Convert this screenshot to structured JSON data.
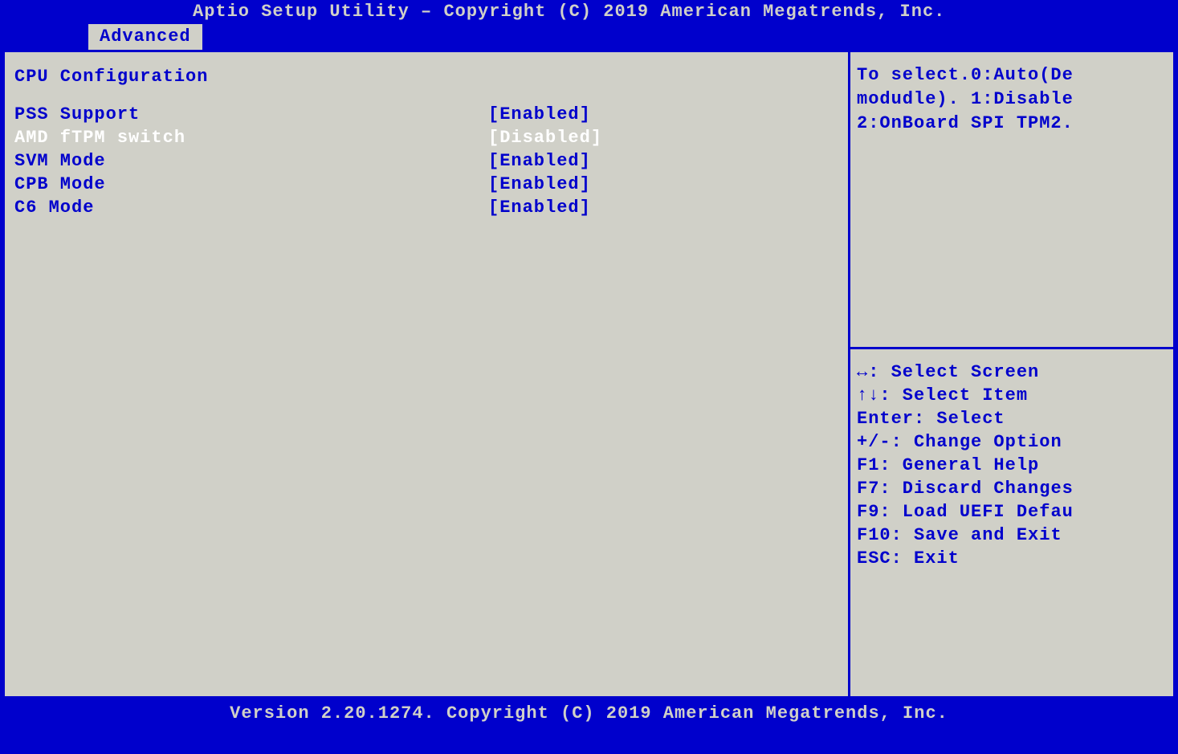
{
  "header": {
    "title": "Aptio Setup Utility – Copyright (C) 2019 American Megatrends, Inc."
  },
  "tabs": [
    {
      "label": "Advanced",
      "active": true
    }
  ],
  "main": {
    "section_title": "CPU Configuration",
    "settings": [
      {
        "label": "PSS Support",
        "value": "[Enabled]",
        "selected": false
      },
      {
        "label": "AMD fTPM switch",
        "value": "[Disabled]",
        "selected": true
      },
      {
        "label": "SVM Mode",
        "value": "[Enabled]",
        "selected": false
      },
      {
        "label": "CPB Mode",
        "value": "[Enabled]",
        "selected": false
      },
      {
        "label": "C6 Mode",
        "value": "[Enabled]",
        "selected": false
      }
    ]
  },
  "side": {
    "help_lines": [
      "To select.0:Auto(De",
      "modudle). 1:Disable",
      "2:OnBoard SPI TPM2."
    ],
    "keys": [
      {
        "key": "↔",
        "desc": ": Select Screen",
        "icon": "arrow-lr"
      },
      {
        "key": "↑↓",
        "desc": ": Select Item",
        "icon": "arrow-ud"
      },
      {
        "key": "Enter",
        "desc": ": Select",
        "icon": ""
      },
      {
        "key": "+/-",
        "desc": ": Change Option",
        "icon": ""
      },
      {
        "key": "F1",
        "desc": ": General Help",
        "icon": ""
      },
      {
        "key": "F7",
        "desc": ": Discard Changes",
        "icon": ""
      },
      {
        "key": "F9",
        "desc": ": Load UEFI Defau",
        "icon": ""
      },
      {
        "key": "F10",
        "desc": ": Save and Exit",
        "icon": ""
      },
      {
        "key": "ESC",
        "desc": ": Exit",
        "icon": ""
      }
    ]
  },
  "footer": {
    "text": "Version 2.20.1274. Copyright (C) 2019 American Megatrends, Inc."
  }
}
